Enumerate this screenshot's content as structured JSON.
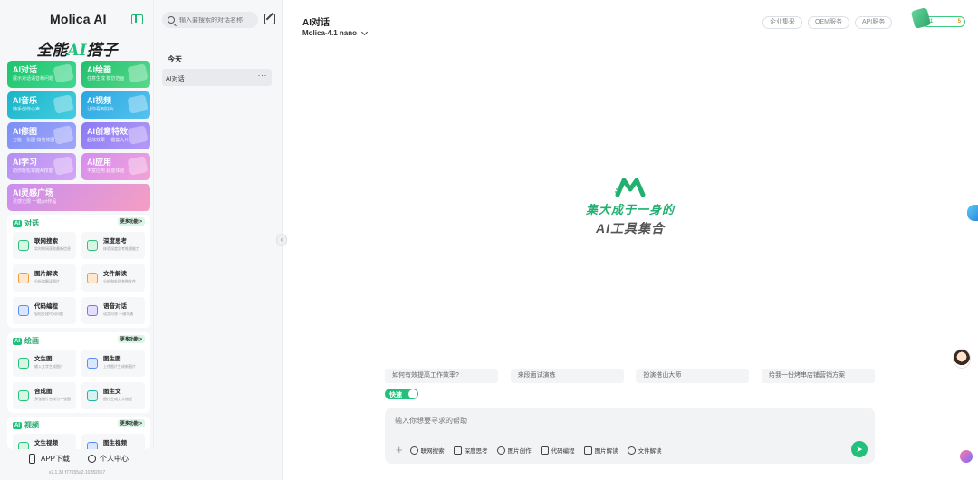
{
  "sidebar": {
    "brand": "Molica AI",
    "slogan_prefix": "全能",
    "slogan_ai": "AI",
    "slogan_suffix": "搭子",
    "tiles": [
      {
        "title": "AI对话",
        "sub": "展示对话语音和问题"
      },
      {
        "title": "AI绘画",
        "sub": "任意生成 模仿范画"
      },
      {
        "title": "AI音乐",
        "sub": "随手创作心声"
      },
      {
        "title": "AI视频",
        "sub": "让你看到好片"
      },
      {
        "title": "AI修图",
        "sub": "万能一张图 微信修图"
      },
      {
        "title": "AI创意特效",
        "sub": "超炫效果 一键套大片"
      },
      {
        "title": "AI学习",
        "sub": "助你轻松掌握AI技能"
      },
      {
        "title": "AI应用",
        "sub": "丰富应用 超能体验"
      },
      {
        "title": "AI灵感广场",
        "sub": "灵感无限 一键get作品"
      }
    ],
    "sections": [
      {
        "badge": "AI",
        "name": "对话",
        "more": "更多功能 >",
        "cards": [
          {
            "title": "联网搜索",
            "sub": "实时联网获取最新信息",
            "icon": "globe-icon"
          },
          {
            "title": "深度思考",
            "sub": "体验深度思考推理能力",
            "icon": "brain-icon"
          },
          {
            "title": "图片解读",
            "sub": "分析和解读图片",
            "icon": "image-icon"
          },
          {
            "title": "文件解读",
            "sub": "分析和处理各种文件",
            "icon": "file-icon"
          },
          {
            "title": "代码编程",
            "sub": "轻松处理代码问题",
            "icon": "code-icon"
          },
          {
            "title": "语音对话",
            "sub": "语音问答 一键沟通",
            "icon": "voice-icon"
          }
        ]
      },
      {
        "badge": "AI",
        "name": "绘画",
        "more": "更多功能 >",
        "cards": [
          {
            "title": "文生图",
            "sub": "输入文字生成图片",
            "icon": "text-image-icon"
          },
          {
            "title": "图生图",
            "sub": "上传图片生成新图片",
            "icon": "image-image-icon"
          },
          {
            "title": "合成图",
            "sub": "多张图片合成为一张图",
            "icon": "merge-icon"
          },
          {
            "title": "图生文",
            "sub": "图片生成文字描述",
            "icon": "image-text-icon"
          }
        ]
      },
      {
        "badge": "AI",
        "name": "视频",
        "more": "更多功能 >",
        "cards": [
          {
            "title": "文生视频",
            "sub": "",
            "icon": "text-video-icon"
          },
          {
            "title": "图生视频",
            "sub": "",
            "icon": "image-video-icon"
          }
        ]
      }
    ],
    "footer": {
      "app_download": "APP下载",
      "personal_center": "个人中心",
      "version": "v2.1.38 f77655a2.10282017"
    }
  },
  "conversations": {
    "search_placeholder": "输入要搜索的对话名称",
    "group_today": "今天",
    "items": [
      {
        "title": "AI对话",
        "more": "···"
      }
    ],
    "collapse_glyph": "‹"
  },
  "main": {
    "title": "AI对话",
    "model": "Molica-4.1 nano",
    "top_links": [
      "企业集采",
      "OEM服务",
      "API服务"
    ],
    "coins": {
      "value1": "1",
      "value2": "5"
    },
    "hero_line1": "集大成于一身的",
    "hero_line2": "AI工具集合",
    "suggestions": [
      "如何有效提高工作效率?",
      "来段面试演练",
      "扮演搭山大师",
      "给我一份烤串店铺营销方案"
    ],
    "fast_mode": "快速",
    "input_placeholder": "输入你想要寻求的帮助",
    "plus_glyph": "+",
    "tools": [
      "联网搜索",
      "深度思考",
      "图片创作",
      "代码编程",
      "图片解读",
      "文件解读"
    ],
    "send_glyph": "➤"
  },
  "colors": {
    "accent": "#22c07a",
    "sidebar_bg": "#f6f7f8",
    "input_bg": "#f2f3f5"
  }
}
